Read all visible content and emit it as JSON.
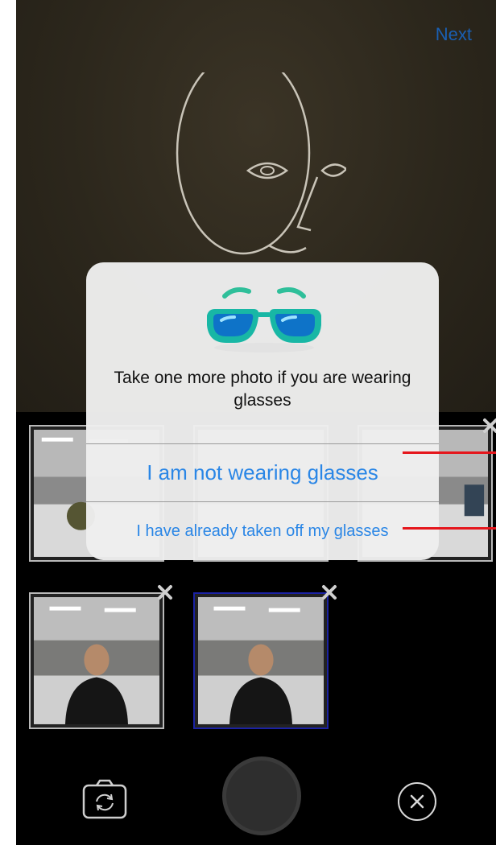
{
  "header": {
    "next_label": "Next"
  },
  "dialog": {
    "message": "Take one more photo if you are wearing glasses",
    "not_wearing_label": "I am not wearing glasses",
    "taken_off_label": "I have already taken off my glasses",
    "icon": "glasses-icon"
  },
  "thumbnails": [
    {
      "row": 1,
      "selected": false
    },
    {
      "row": 1,
      "selected": false
    },
    {
      "row": 1,
      "selected": false
    },
    {
      "row": 2,
      "selected": false
    },
    {
      "row": 2,
      "selected": true
    }
  ],
  "bottom_bar": {
    "flip_icon": "camera-flip-icon",
    "shutter_icon": "shutter-button",
    "close_icon": "close-icon"
  },
  "colors": {
    "accent": "#2a86e6",
    "selected_border": "#1b22a3",
    "annotation": "#e5161c"
  }
}
